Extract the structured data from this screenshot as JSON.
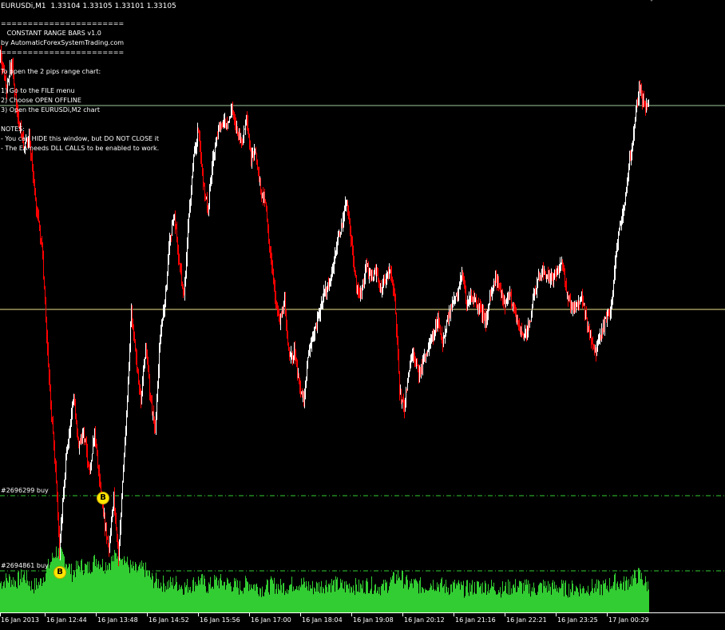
{
  "header": {
    "title": "EURUSDi,M1  1.33104 1.33105 1.33101 1.33105"
  },
  "info_panel": {
    "lines": [
      "=======================",
      "   CONSTANT RANGE BARS v1.0",
      "by AutomaticForexSystemTrading.com",
      "=======================",
      "",
      "To open the 2 pips range chart:",
      "",
      "1) Go to the FILE menu",
      "2) Choose OPEN OFFLINE",
      "3) Open the EURUSDi,M2 chart",
      "",
      "NOTES:",
      "- You can HIDE this window, but DO NOT CLOSE it",
      "- The EA needs DLL CALLS to be enabled to work."
    ]
  },
  "orders": [
    {
      "label": "#2696299 buy",
      "marker": "B"
    },
    {
      "label": "#2694861 buy",
      "marker": "B"
    }
  ],
  "colors": {
    "background": "#000000",
    "candle_down": "#ff0000",
    "candle_up": "#ffffff",
    "volume": "#32cd32",
    "ask_line": "#9ec79e",
    "bid_line": "#f0e68c",
    "order_line": "#32cd32",
    "marker": "#ffe600"
  },
  "x_axis": {
    "labels": [
      "16 Jan 2013",
      "16 Jan 12:44",
      "16 Jan 13:48",
      "16 Jan 14:52",
      "16 Jan 15:56",
      "16 Jan 17:00",
      "16 Jan 18:04",
      "16 Jan 19:08",
      "16 Jan 20:12",
      "16 Jan 21:16",
      "16 Jan 22:21",
      "16 Jan 23:25",
      "17 Jan 00:29"
    ]
  },
  "chart_data": {
    "type": "candlestick",
    "symbol": "EURUSDi",
    "timeframe": "M1",
    "last_bar": {
      "open": 1.33104,
      "high": 1.33105,
      "low": 1.33101,
      "close": 1.33105
    },
    "price_trace": [
      [
        0,
        70
      ],
      [
        8,
        110
      ],
      [
        14,
        75
      ],
      [
        22,
        150
      ],
      [
        30,
        185
      ],
      [
        36,
        170
      ],
      [
        44,
        250
      ],
      [
        52,
        310
      ],
      [
        58,
        420
      ],
      [
        64,
        520
      ],
      [
        70,
        600
      ],
      [
        74,
        690
      ],
      [
        80,
        600
      ],
      [
        86,
        540
      ],
      [
        92,
        500
      ],
      [
        98,
        560
      ],
      [
        104,
        540
      ],
      [
        112,
        590
      ],
      [
        118,
        540
      ],
      [
        124,
        600
      ],
      [
        130,
        650
      ],
      [
        136,
        690
      ],
      [
        142,
        620
      ],
      [
        148,
        700
      ],
      [
        152,
        620
      ],
      [
        158,
        520
      ],
      [
        164,
        390
      ],
      [
        170,
        450
      ],
      [
        176,
        500
      ],
      [
        182,
        430
      ],
      [
        188,
        500
      ],
      [
        194,
        540
      ],
      [
        200,
        420
      ],
      [
        206,
        380
      ],
      [
        212,
        300
      ],
      [
        218,
        270
      ],
      [
        224,
        330
      ],
      [
        230,
        370
      ],
      [
        236,
        270
      ],
      [
        242,
        200
      ],
      [
        248,
        160
      ],
      [
        254,
        230
      ],
      [
        260,
        260
      ],
      [
        266,
        200
      ],
      [
        272,
        170
      ],
      [
        278,
        150
      ],
      [
        284,
        160
      ],
      [
        290,
        135
      ],
      [
        296,
        160
      ],
      [
        302,
        180
      ],
      [
        308,
        150
      ],
      [
        314,
        200
      ],
      [
        320,
        190
      ],
      [
        326,
        240
      ],
      [
        332,
        250
      ],
      [
        338,
        320
      ],
      [
        344,
        370
      ],
      [
        350,
        400
      ],
      [
        356,
        380
      ],
      [
        362,
        450
      ],
      [
        368,
        440
      ],
      [
        374,
        480
      ],
      [
        380,
        500
      ],
      [
        386,
        440
      ],
      [
        392,
        420
      ],
      [
        398,
        400
      ],
      [
        404,
        370
      ],
      [
        410,
        360
      ],
      [
        416,
        340
      ],
      [
        422,
        300
      ],
      [
        428,
        280
      ],
      [
        434,
        250
      ],
      [
        440,
        310
      ],
      [
        446,
        360
      ],
      [
        452,
        370
      ],
      [
        458,
        330
      ],
      [
        464,
        350
      ],
      [
        470,
        340
      ],
      [
        476,
        360
      ],
      [
        482,
        350
      ],
      [
        488,
        340
      ],
      [
        494,
        370
      ],
      [
        500,
        490
      ],
      [
        506,
        510
      ],
      [
        512,
        460
      ],
      [
        518,
        440
      ],
      [
        524,
        470
      ],
      [
        530,
        450
      ],
      [
        536,
        440
      ],
      [
        542,
        420
      ],
      [
        548,
        400
      ],
      [
        554,
        430
      ],
      [
        560,
        400
      ],
      [
        566,
        380
      ],
      [
        572,
        370
      ],
      [
        578,
        340
      ],
      [
        584,
        380
      ],
      [
        590,
        370
      ],
      [
        596,
        380
      ],
      [
        602,
        390
      ],
      [
        608,
        400
      ],
      [
        614,
        370
      ],
      [
        620,
        350
      ],
      [
        626,
        360
      ],
      [
        632,
        380
      ],
      [
        638,
        370
      ],
      [
        644,
        390
      ],
      [
        650,
        410
      ],
      [
        656,
        420
      ],
      [
        662,
        410
      ],
      [
        668,
        370
      ],
      [
        674,
        350
      ],
      [
        680,
        340
      ],
      [
        686,
        350
      ],
      [
        692,
        345
      ],
      [
        698,
        340
      ],
      [
        704,
        330
      ],
      [
        710,
        370
      ],
      [
        716,
        390
      ],
      [
        722,
        380
      ],
      [
        728,
        370
      ],
      [
        734,
        400
      ],
      [
        740,
        430
      ],
      [
        746,
        440
      ],
      [
        752,
        420
      ],
      [
        758,
        400
      ],
      [
        764,
        390
      ],
      [
        770,
        330
      ],
      [
        776,
        280
      ],
      [
        782,
        250
      ],
      [
        788,
        200
      ],
      [
        794,
        160
      ],
      [
        800,
        110
      ],
      [
        806,
        130
      ],
      [
        812,
        130
      ]
    ],
    "volume_profile": [
      [
        0,
        740
      ],
      [
        10,
        735
      ],
      [
        20,
        738
      ],
      [
        30,
        730
      ],
      [
        40,
        745
      ],
      [
        50,
        740
      ],
      [
        60,
        720
      ],
      [
        70,
        700
      ],
      [
        80,
        708
      ],
      [
        90,
        728
      ],
      [
        100,
        718
      ],
      [
        110,
        722
      ],
      [
        120,
        710
      ],
      [
        130,
        718
      ],
      [
        140,
        712
      ],
      [
        150,
        700
      ],
      [
        160,
        718
      ],
      [
        170,
        725
      ],
      [
        180,
        722
      ],
      [
        190,
        736
      ],
      [
        200,
        740
      ],
      [
        210,
        742
      ],
      [
        220,
        740
      ],
      [
        230,
        745
      ],
      [
        240,
        742
      ],
      [
        250,
        736
      ],
      [
        260,
        745
      ],
      [
        270,
        738
      ],
      [
        280,
        740
      ],
      [
        290,
        742
      ],
      [
        300,
        746
      ],
      [
        310,
        740
      ],
      [
        320,
        744
      ],
      [
        330,
        748
      ],
      [
        340,
        742
      ],
      [
        350,
        745
      ],
      [
        360,
        744
      ],
      [
        370,
        740
      ],
      [
        380,
        742
      ],
      [
        390,
        746
      ],
      [
        400,
        744
      ],
      [
        410,
        741
      ],
      [
        420,
        742
      ],
      [
        430,
        745
      ],
      [
        440,
        743
      ],
      [
        450,
        746
      ],
      [
        460,
        742
      ],
      [
        470,
        744
      ],
      [
        480,
        746
      ],
      [
        490,
        738
      ],
      [
        500,
        730
      ],
      [
        510,
        742
      ],
      [
        520,
        742
      ],
      [
        530,
        745
      ],
      [
        540,
        740
      ],
      [
        550,
        742
      ],
      [
        560,
        746
      ],
      [
        570,
        744
      ],
      [
        580,
        748
      ],
      [
        590,
        746
      ],
      [
        600,
        745
      ],
      [
        610,
        744
      ],
      [
        620,
        746
      ],
      [
        630,
        748
      ],
      [
        640,
        745
      ],
      [
        650,
        744
      ],
      [
        660,
        746
      ],
      [
        670,
        748
      ],
      [
        680,
        744
      ],
      [
        690,
        746
      ],
      [
        700,
        745
      ],
      [
        710,
        748
      ],
      [
        720,
        746
      ],
      [
        730,
        748
      ],
      [
        740,
        745
      ],
      [
        750,
        747
      ],
      [
        760,
        744
      ],
      [
        770,
        738
      ],
      [
        780,
        742
      ],
      [
        790,
        736
      ],
      [
        800,
        730
      ],
      [
        812,
        745
      ]
    ]
  }
}
